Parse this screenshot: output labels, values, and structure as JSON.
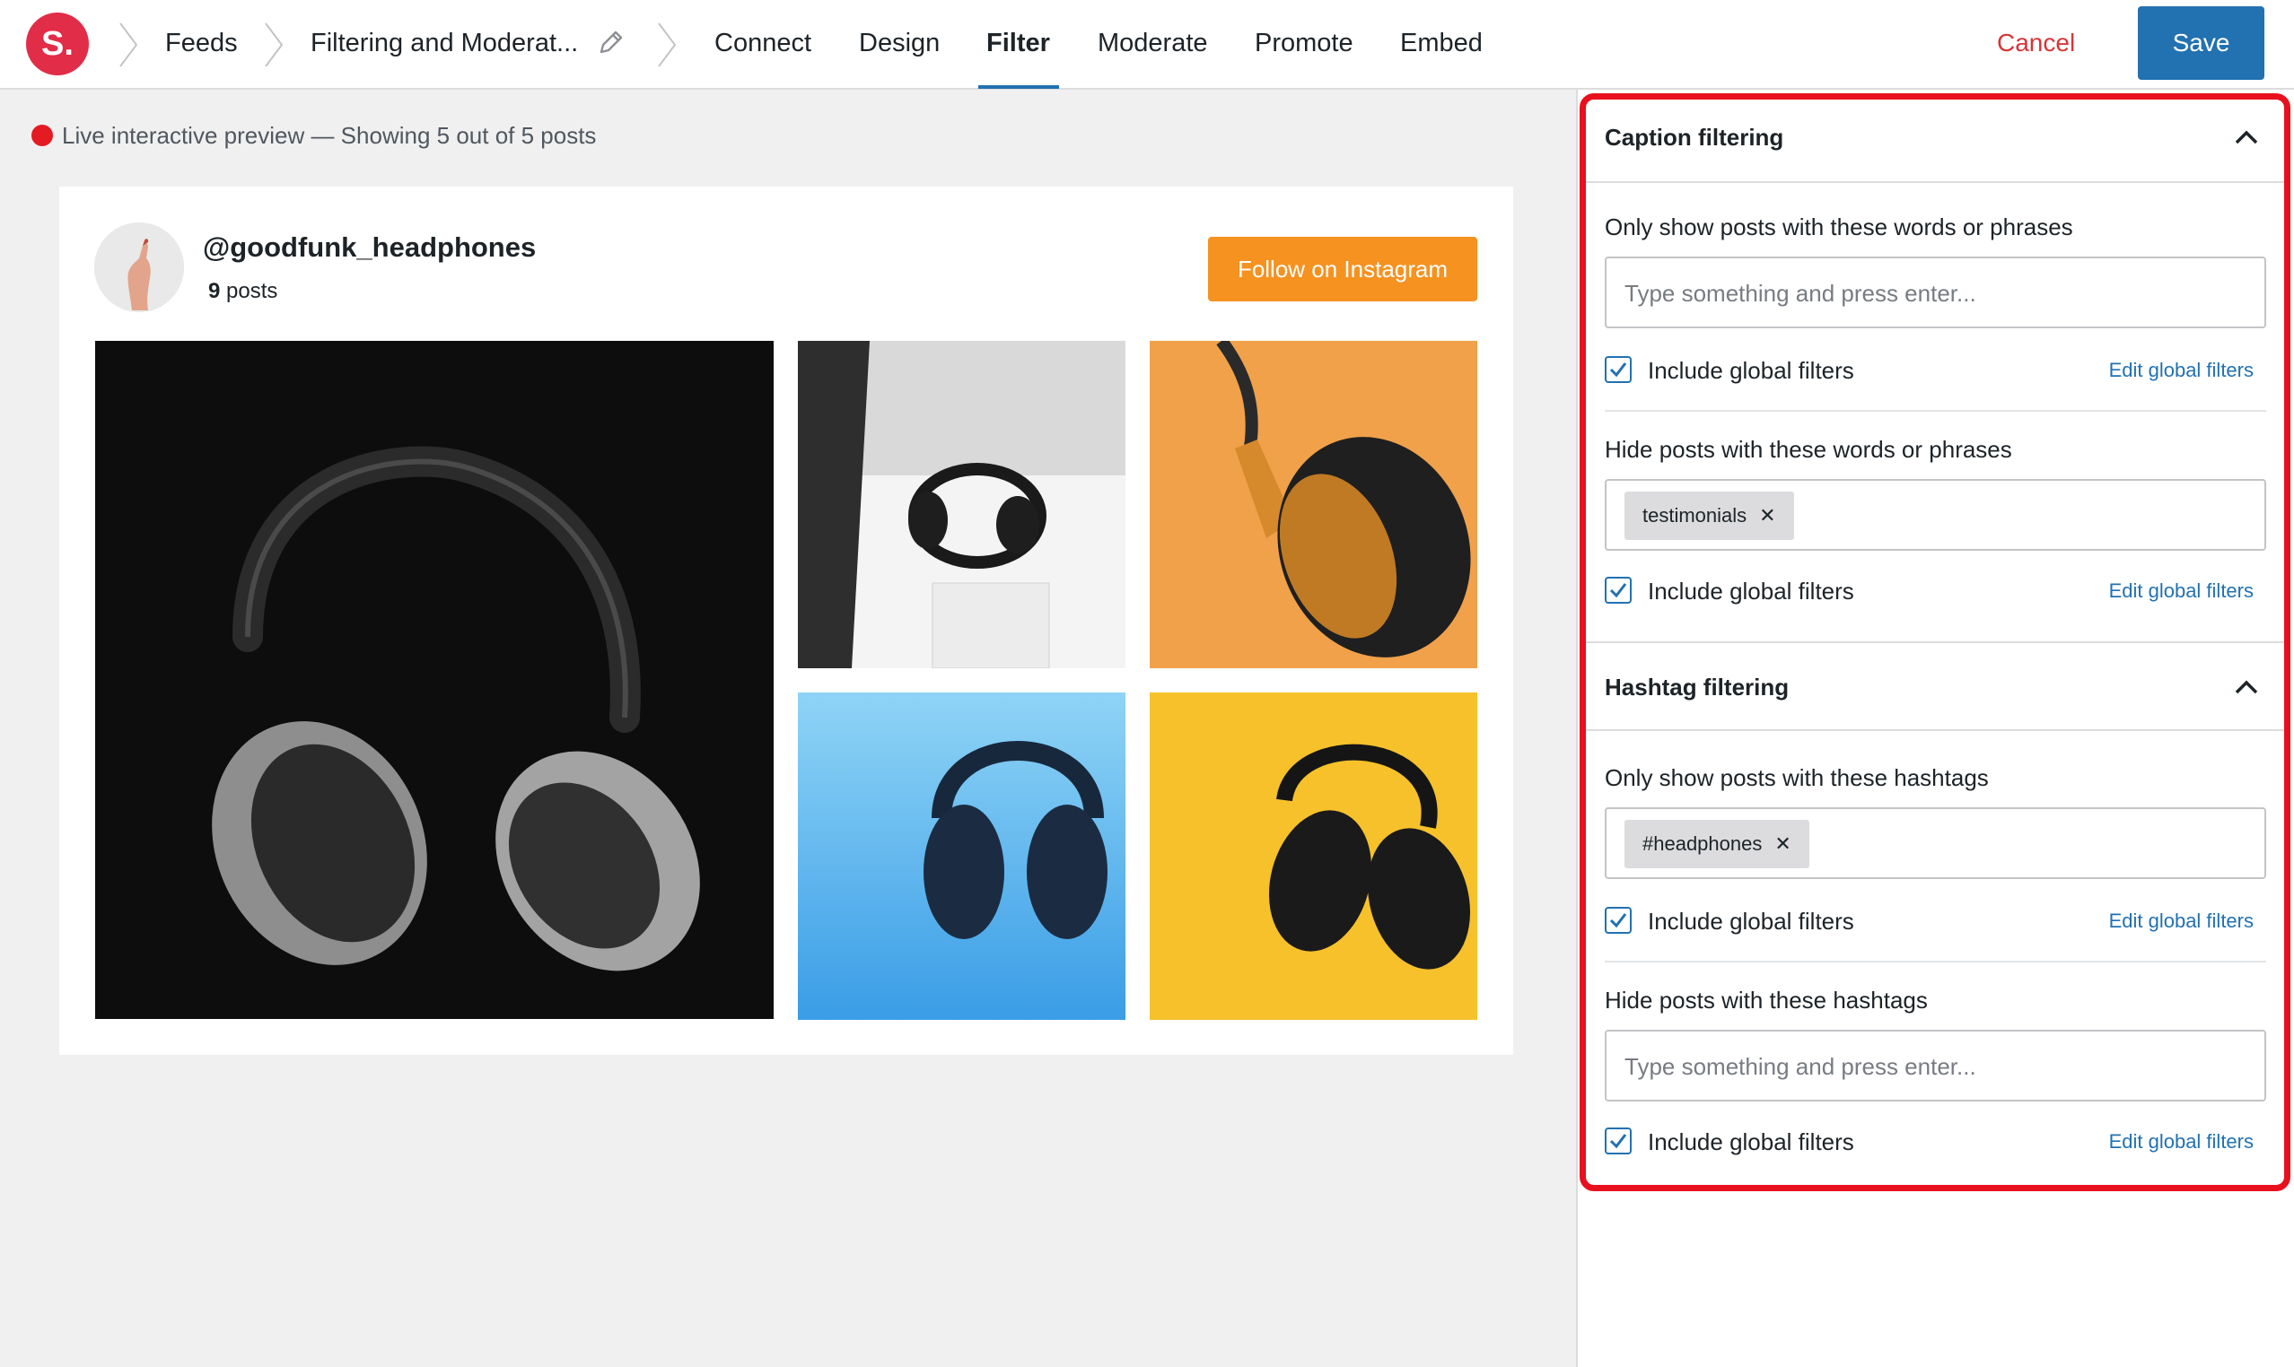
{
  "app": {
    "logo_text": "S.",
    "brand_color": "#e12d48",
    "accent_color": "#2271b1"
  },
  "breadcrumb": {
    "feeds": "Feeds",
    "current": "Filtering and Moderat..."
  },
  "tabs": [
    "Connect",
    "Design",
    "Filter",
    "Moderate",
    "Promote",
    "Embed"
  ],
  "active_tab": "Filter",
  "header_actions": {
    "cancel": "Cancel",
    "save": "Save"
  },
  "preview": {
    "status": "Live interactive preview — Showing 5 out of 5 posts",
    "username": "@goodfunk_headphones",
    "posts_count": "9",
    "posts_label": "posts",
    "follow_button": "Follow on Instagram"
  },
  "sidebar": {
    "caption": {
      "title": "Caption filtering",
      "show_label": "Only show posts with these words or phrases",
      "show_placeholder": "Type something and press enter...",
      "hide_label": "Hide posts with these words or phrases",
      "hide_chip": "testimonials"
    },
    "hashtag": {
      "title": "Hashtag filtering",
      "show_label": "Only show posts with these hashtags",
      "show_chip": "#headphones",
      "hide_label": "Hide posts with these hashtags",
      "hide_placeholder": "Type something and press enter..."
    },
    "include_global": "Include global filters",
    "edit_global": "Edit global filters",
    "chip_remove": "✕"
  }
}
